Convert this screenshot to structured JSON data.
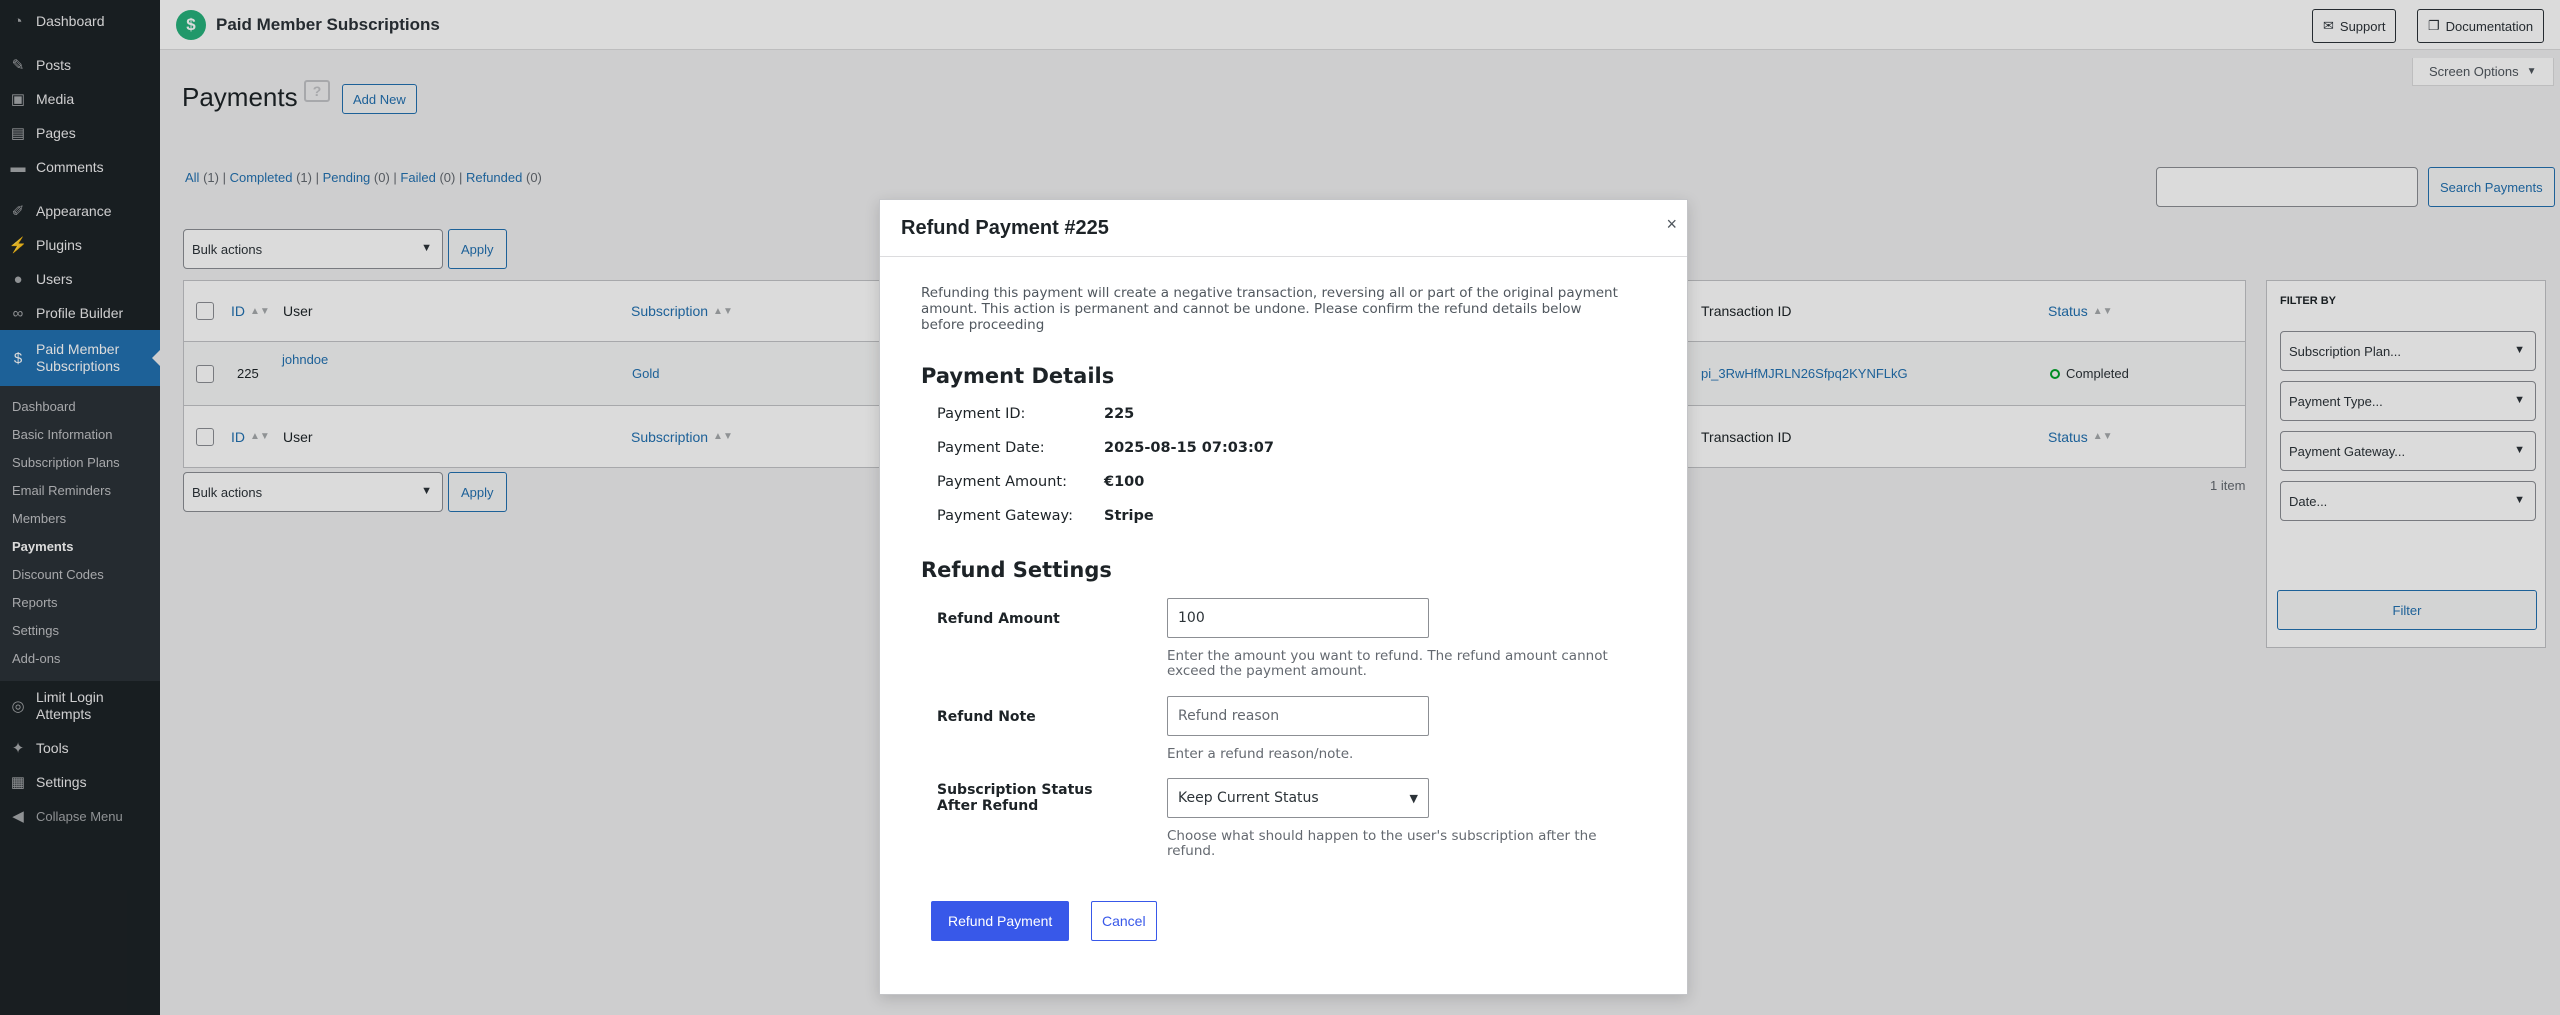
{
  "sidebar": {
    "top_items": [
      {
        "label": "Dashboard",
        "icon": "dashboard-icon"
      },
      {
        "label": "Posts",
        "icon": "pin-icon"
      },
      {
        "label": "Media",
        "icon": "media-icon"
      },
      {
        "label": "Pages",
        "icon": "page-icon"
      },
      {
        "label": "Comments",
        "icon": "comment-icon"
      },
      {
        "label": "Appearance",
        "icon": "brush-icon"
      },
      {
        "label": "Plugins",
        "icon": "plug-icon"
      },
      {
        "label": "Users",
        "icon": "user-icon"
      },
      {
        "label": "Profile Builder",
        "icon": "profile-icon"
      }
    ],
    "active_item": {
      "label": "Paid Member Subscriptions",
      "icon": "dollar-icon"
    },
    "submenu": [
      "Dashboard",
      "Basic Information",
      "Subscription Plans",
      "Email Reminders",
      "Members",
      "Payments",
      "Discount Codes",
      "Reports",
      "Settings",
      "Add-ons"
    ],
    "current_submenu": "Payments",
    "bottom_items": [
      {
        "label": "Limit Login Attempts",
        "icon": "fingerprint-icon"
      },
      {
        "label": "Tools",
        "icon": "wrench-icon"
      },
      {
        "label": "Settings",
        "icon": "settings-icon"
      }
    ],
    "collapse_label": "Collapse Menu"
  },
  "header": {
    "title": "Paid Member Subscriptions",
    "support_label": "Support",
    "docs_label": "Documentation",
    "screen_options_label": "Screen Options"
  },
  "page": {
    "heading": "Payments",
    "help_icon_label": "?",
    "add_new_label": "Add New",
    "status_filters": [
      {
        "label": "All",
        "count": "(1)"
      },
      {
        "label": "Completed",
        "count": "(1)"
      },
      {
        "label": "Pending",
        "count": "(0)"
      },
      {
        "label": "Failed",
        "count": "(0)"
      },
      {
        "label": "Refunded",
        "count": "(0)"
      }
    ],
    "search_button_label": "Search Payments",
    "bulk_actions_label": "Bulk actions",
    "apply_label": "Apply",
    "items_count": "1 item"
  },
  "table": {
    "columns": {
      "id": "ID",
      "user": "User",
      "subscription": "Subscription",
      "transaction_id": "Transaction ID",
      "status": "Status"
    },
    "row": {
      "id": "225",
      "user": "johndoe",
      "subscription": "Gold",
      "transaction_id": "pi_3RwHfMJRLN26Sfpq2KYNFLkG",
      "status": "Completed"
    }
  },
  "filter": {
    "heading": "FILTER BY",
    "selects": [
      "Subscription Plan...",
      "Payment Type...",
      "Payment Gateway...",
      "Date..."
    ],
    "button_label": "Filter"
  },
  "modal": {
    "title": "Refund Payment #225",
    "close_glyph": "×",
    "intro": "Refunding this payment will create a negative transaction, reversing all or part of the original payment amount. This action is permanent and cannot be undone. Please confirm the refund details below before proceeding",
    "details_title": "Payment Details",
    "details": [
      {
        "label": "Payment ID:",
        "value": "225"
      },
      {
        "label": "Payment Date:",
        "value": "2025-08-15 07:03:07"
      },
      {
        "label": "Payment Amount:",
        "value": "€100"
      },
      {
        "label": "Payment Gateway:",
        "value": "Stripe"
      }
    ],
    "settings_title": "Refund Settings",
    "refund_amount_label": "Refund Amount",
    "refund_amount_value": "100",
    "refund_amount_help": "Enter the amount you want to refund. The refund amount cannot exceed the payment amount.",
    "refund_note_label": "Refund Note",
    "refund_note_placeholder": "Refund reason",
    "refund_note_help": "Enter a refund reason/note.",
    "status_after_label": "Subscription Status After Refund",
    "status_after_value": "Keep Current Status",
    "status_after_help": "Choose what should happen to the user's subscription after the refund.",
    "refund_button_label": "Refund Payment",
    "cancel_button_label": "Cancel"
  },
  "colors": {
    "sidebar_bg": "#1d2327",
    "active_menu": "#2271b1",
    "modal_primary": "#3858e9",
    "brand_green": "#27b27c",
    "status_complete": "#00a32a"
  }
}
